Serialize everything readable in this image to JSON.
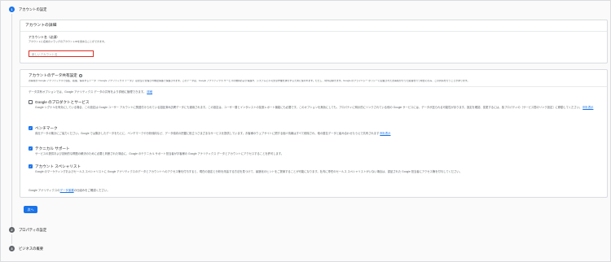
{
  "steps": [
    {
      "num": "1",
      "label": "アカウントの設定"
    },
    {
      "num": "2",
      "label": "プロパティの設定"
    },
    {
      "num": "3",
      "label": "ビジネスの概要"
    }
  ],
  "details": {
    "title": "アカウントの詳細",
    "name_label": "アカウント名（必須）",
    "name_help": "アカウントに名前のドラッグのアカウントIDを含めることができます。",
    "name_placeholder": "新しいアカウント名"
  },
  "sharing": {
    "title": "アカウントのデータ共有設定",
    "help_icon": "?",
    "desc": "お客様が Google アナリティクスで収集、処理、保存するデータ（「Google アナリティクス データ」）は安全に管理され機密保護で保護されます。このデータは、Google アナリティクス サービスの維持および保護や、システムに不可欠な作業を遂行するために使われます。ただし、例外は除きます。Google のプライバシー ポリシーに記載されたお客様が行った処理を行う場合にのみ、この共有を行うことがあります。",
    "intro": "データ共有オプションでは、Google アナリティクス データの共有をより詳細に管理できます。",
    "intro_link": "詳細",
    "options": [
      {
        "title": "Google のプロダクトとサービス",
        "checked": false,
        "desc": "Google シグナルを有効にしている場合、この設定は Google ユーザー アカウントに関連付けられている認証済み訪問データにも適用されます。この設定は、ユーザー層とインタレストの拡張レポート機能にも必要です。このオプションを無効にしても、プロパティに明示的にリンクされている他の Google サービスには、データが送られる可能性があります。設定を確認、変更するには、各プロパティの［サービス間のリンク設定］に移動してください。",
        "link": "例を表示"
      },
      {
        "title": "ベンチマーク",
        "checked": true,
        "desc": "貴社データの集計にご協力ください。Google では集計したデータをもとに、ベンチマークや分析傾向など、データ傾向の把握に役立つさまざまなサービスを提供しています。お客様のウェブサイトに関する個人情報はすべて削除され、他の匿名データと組み合わせたうえで共有されます",
        "link": "例を表示"
      },
      {
        "title": "テクニカル サポート",
        "checked": true,
        "desc": "サービスの提供および技術的な問題の解決のために必要と判断された場合に、Google のテクニカル サポート担当者がお客様の Google アナリティクス データとアカウントにアクセスすることを許可します。",
        "link": ""
      },
      {
        "title": "アカウント スペシャリスト",
        "checked": true,
        "desc": "Google のマーケティングおよびセールス スペシャリストに Google アナリティクスのデータとアカウントへのアクセス権を付与すると、現在の設定と分析を改善する方法を見つけて、最適化のヒントをご提案することが可能になります。社内に専任のセールス スペシャリストがいない場合は、認証された Google 担当者にアクセス権を付与してください。",
        "link": ""
      }
    ],
    "footer_pre": "Google アナリティクスの",
    "footer_link": "データ保護",
    "footer_post": "の仕組みをご確認ください。"
  },
  "next_button": "次へ",
  "colors": {
    "accent": "#1a73e8",
    "error": "#d93025"
  }
}
